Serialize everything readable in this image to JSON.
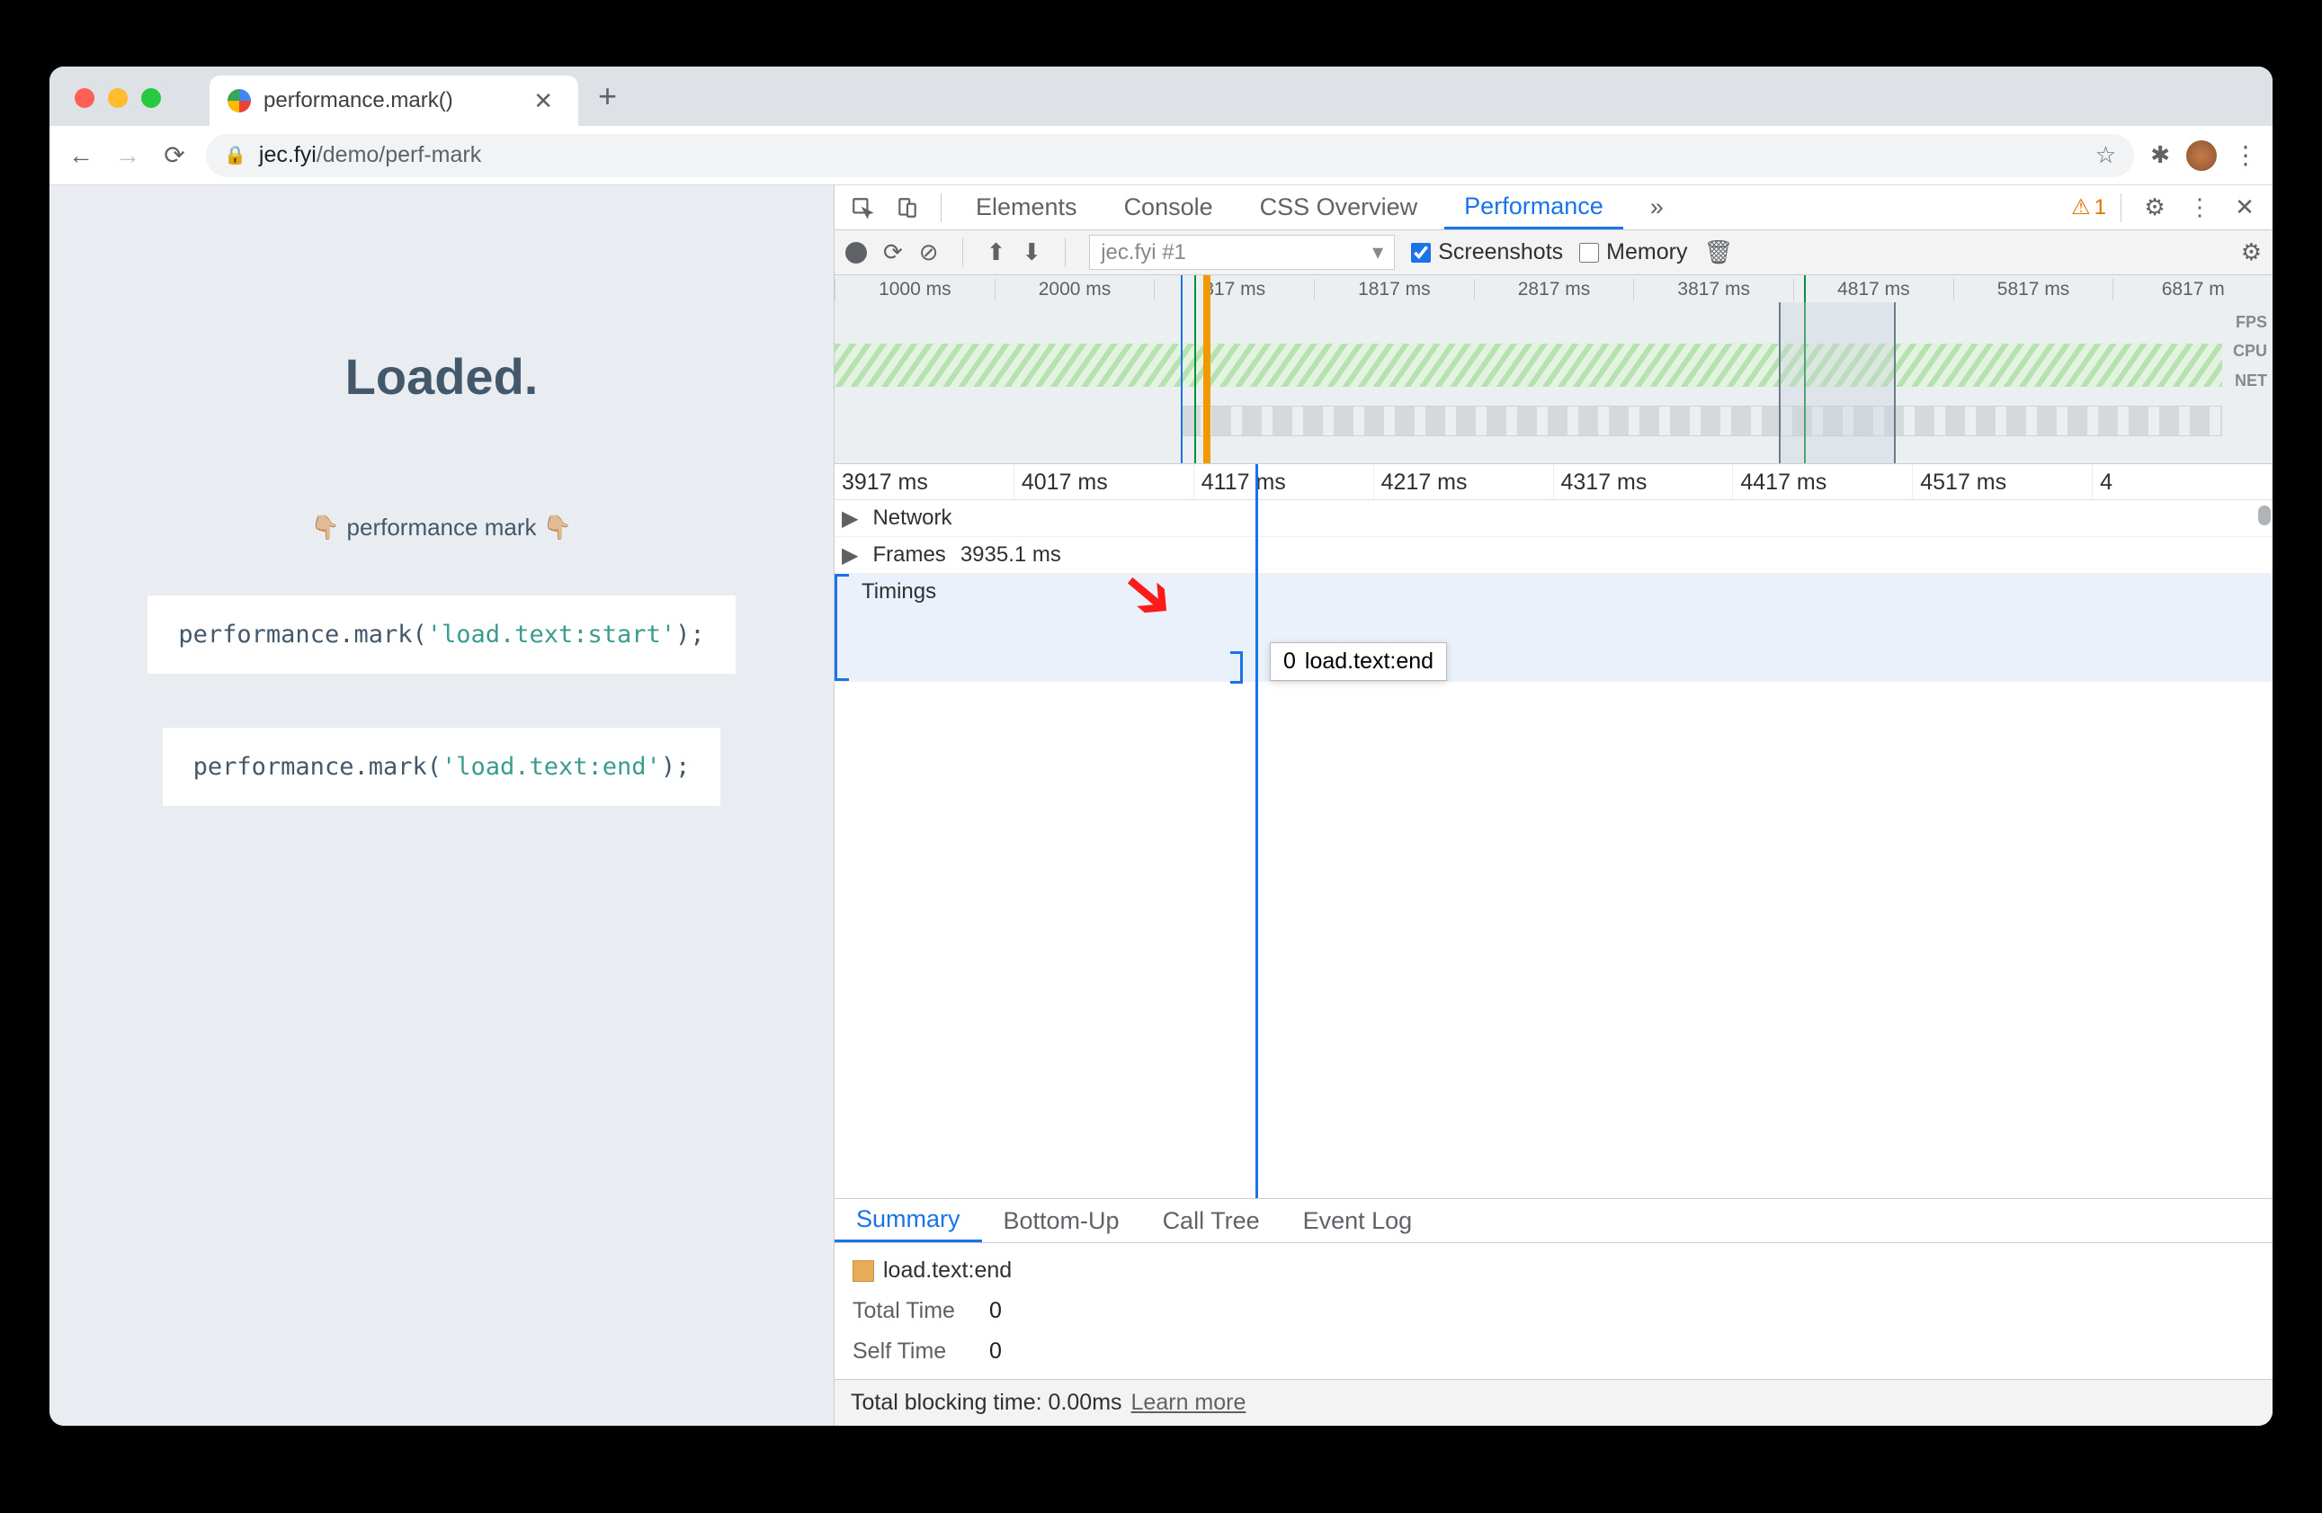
{
  "browser": {
    "tab_title": "performance.mark()",
    "url_domain": "jec.fyi",
    "url_path": "/demo/perf-mark"
  },
  "page": {
    "heading": "Loaded.",
    "subheading": "👇🏼 performance mark 👇🏼",
    "code1_call": "performance.mark(",
    "code1_arg": "'load.text:start'",
    "code1_end": ");",
    "code2_call": "performance.mark(",
    "code2_arg": "'load.text:end'",
    "code2_end": ");"
  },
  "devtools": {
    "tabs": [
      "Elements",
      "Console",
      "CSS Overview",
      "Performance"
    ],
    "active_tab": "Performance",
    "more_tabs": "»",
    "warning_count": "1",
    "session": "jec.fyi #1",
    "screenshots_label": "Screenshots",
    "memory_label": "Memory"
  },
  "overview": {
    "ticks": [
      "1000 ms",
      "2000 ms",
      "817 ms",
      "1817 ms",
      "2817 ms",
      "3817 ms",
      "4817 ms",
      "5817 ms",
      "6817 m"
    ],
    "labels": [
      "FPS",
      "CPU",
      "NET"
    ]
  },
  "flame": {
    "ticks": [
      "3917 ms",
      "4017 ms",
      "4117 ms",
      "4217 ms",
      "4317 ms",
      "4417 ms",
      "4517 ms",
      "4"
    ],
    "track_network": "Network",
    "track_frames": "Frames",
    "frames_value": "3935.1 ms",
    "track_timings": "Timings",
    "tooltip_val": "0",
    "tooltip_label": "load.text:end"
  },
  "detail": {
    "tabs": [
      "Summary",
      "Bottom-Up",
      "Call Tree",
      "Event Log"
    ],
    "active": "Summary",
    "entry_name": "load.text:end",
    "total_label": "Total Time",
    "total_value": "0",
    "self_label": "Self Time",
    "self_value": "0"
  },
  "status": {
    "text": "Total blocking time: 0.00ms",
    "link": "Learn more"
  }
}
